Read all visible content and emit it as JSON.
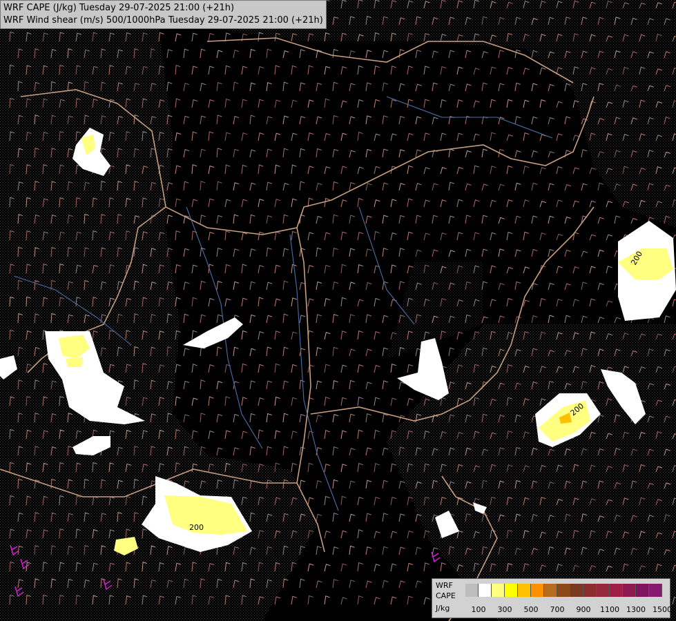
{
  "titles": {
    "line1": "WRF CAPE (J/kg) Tuesday 29-07-2025 21:00 (+21h)",
    "line2": "WRF Wind shear (m/s) 500/1000hPa Tuesday 29-07-2025 21:00 (+21h)"
  },
  "contour_labels": [
    "200",
    "200",
    "200"
  ],
  "legend": {
    "label1": "WRF",
    "label2": "CAPE",
    "label3": "J/kg",
    "colors": [
      "#bdbdbd",
      "#ffffff",
      "#ffff80",
      "#ffff00",
      "#ffc000",
      "#ff9000",
      "#b86c20",
      "#8c4a18",
      "#7a3a22",
      "#8a2e2e",
      "#96283c",
      "#a01f46",
      "#8e1a52",
      "#7e1460",
      "#861a70"
    ],
    "ticks": [
      "100",
      "300",
      "500",
      "700",
      "900",
      "1100",
      "1300",
      "1500"
    ]
  }
}
